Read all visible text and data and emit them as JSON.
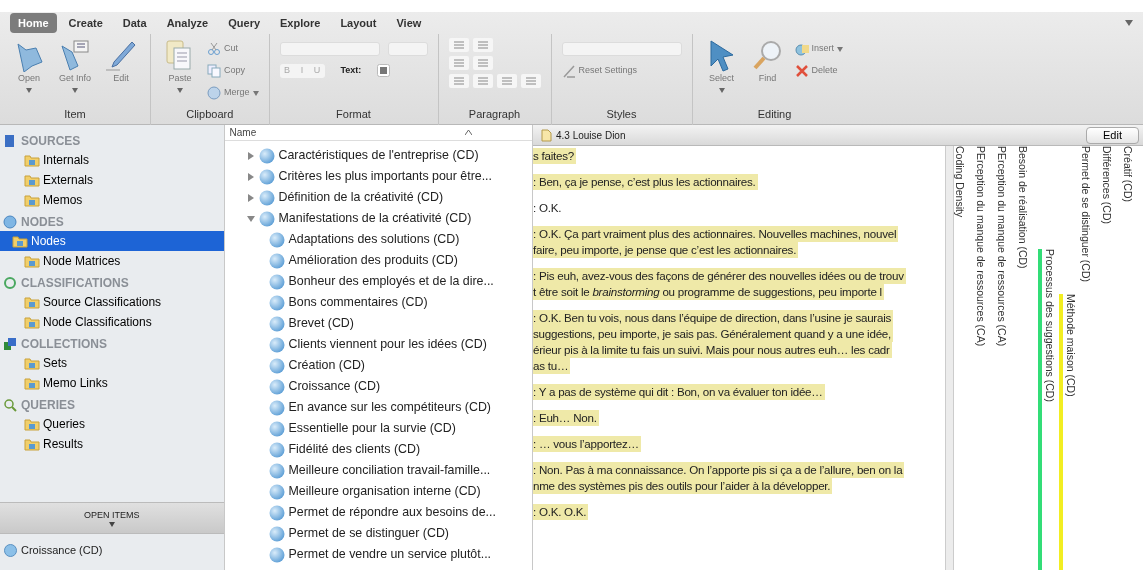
{
  "ribbon": {
    "tabs": [
      {
        "label": "Home",
        "selected": true
      },
      {
        "label": "Create",
        "selected": false
      },
      {
        "label": "Data",
        "selected": false
      },
      {
        "label": "Analyze",
        "selected": false
      },
      {
        "label": "Query",
        "selected": false
      },
      {
        "label": "Explore",
        "selected": false
      },
      {
        "label": "Layout",
        "selected": false
      },
      {
        "label": "View",
        "selected": false
      }
    ],
    "groups": [
      {
        "label": "Item",
        "controls": [
          {
            "kind": "large",
            "label": "Open",
            "disabled": true,
            "menu": true
          },
          {
            "kind": "large",
            "label": "Get Info",
            "disabled": true,
            "menu": true
          },
          {
            "kind": "large",
            "label": "Edit",
            "disabled": true,
            "menu": false
          }
        ]
      },
      {
        "label": "Clipboard",
        "controls": [
          {
            "kind": "large",
            "label": "Paste",
            "disabled": true,
            "menu": true
          },
          {
            "kind": "small",
            "label": "Cut",
            "disabled": true,
            "menu": false
          },
          {
            "kind": "small",
            "label": "Copy",
            "disabled": true,
            "menu": false
          },
          {
            "kind": "small",
            "label": "Merge",
            "disabled": true,
            "menu": true
          }
        ]
      },
      {
        "label": "Format",
        "controls": [
          {
            "kind": "selects"
          },
          {
            "kind": "style-buttons",
            "labels": [
              "B",
              "I",
              "U"
            ],
            "disabled": true
          },
          {
            "kind": "color",
            "label": "Text:"
          }
        ]
      },
      {
        "label": "Paragraph",
        "controls": [
          {
            "kind": "paragraph"
          }
        ]
      },
      {
        "label": "Styles",
        "controls": [
          {
            "kind": "style-select"
          },
          {
            "kind": "small",
            "label": "Reset Settings",
            "disabled": true,
            "menu": false
          }
        ]
      },
      {
        "label": "Editing",
        "controls": [
          {
            "kind": "large",
            "label": "Select",
            "disabled": true,
            "menu": true
          },
          {
            "kind": "large",
            "label": "Find",
            "disabled": true,
            "menu": false
          },
          {
            "kind": "small",
            "label": "Insert",
            "disabled": true,
            "menu": true
          },
          {
            "kind": "small",
            "label": "Delete",
            "disabled": true,
            "menu": false
          }
        ]
      }
    ]
  },
  "sidebar": {
    "sections": [
      {
        "title": "SOURCES",
        "items": [
          {
            "label": "Internals",
            "selected": false
          },
          {
            "label": "Externals",
            "selected": false
          },
          {
            "label": "Memos",
            "selected": false
          }
        ]
      },
      {
        "title": "NODES",
        "items": [
          {
            "label": "Nodes",
            "selected": true
          },
          {
            "label": "Node Matrices",
            "selected": false
          }
        ]
      },
      {
        "title": "CLASSIFICATIONS",
        "items": [
          {
            "label": "Source Classifications",
            "selected": false
          },
          {
            "label": "Node Classifications",
            "selected": false
          }
        ]
      },
      {
        "title": "COLLECTIONS",
        "items": [
          {
            "label": "Sets",
            "selected": false
          },
          {
            "label": "Memo Links",
            "selected": false
          }
        ]
      },
      {
        "title": "QUERIES",
        "items": [
          {
            "label": "Queries",
            "selected": false
          },
          {
            "label": "Results",
            "selected": false
          }
        ]
      }
    ],
    "open_items_label": "OPEN ITEMS",
    "open_items": [
      "Croissance (CD)"
    ]
  },
  "node_list": {
    "column": "Name",
    "nodes": [
      {
        "label": "Caractéristiques de l'entreprise (CD)",
        "expanded": false
      },
      {
        "label": "Critères les plus importants pour être...",
        "expanded": false
      },
      {
        "label": "Définition de la créativité (CD)",
        "expanded": false
      },
      {
        "label": "Manifestations de la créativité (CD)",
        "expanded": true,
        "children": [
          {
            "label": "Adaptations des solutions (CD)"
          },
          {
            "label": "Amélioration des produits (CD)"
          },
          {
            "label": "Bonheur des employés et de la dire..."
          },
          {
            "label": "Bons commentaires (CD)"
          },
          {
            "label": "Brevet (CD)"
          },
          {
            "label": "Clients viennent pour les idées (CD)"
          },
          {
            "label": "Création (CD)"
          },
          {
            "label": "Croissance (CD)"
          },
          {
            "label": "En avance sur les compétiteurs (CD)"
          },
          {
            "label": "Essentielle pour la survie (CD)"
          },
          {
            "label": "Fidélité des clients (CD)"
          },
          {
            "label": "Meilleure conciliation travail-famille..."
          },
          {
            "label": "Meilleure organisation interne (CD)"
          },
          {
            "label": "Permet de répondre aux besoins de..."
          },
          {
            "label": "Permet de se distinguer (CD)"
          },
          {
            "label": "Permet de vendre un service plutôt..."
          }
        ]
      }
    ]
  },
  "document": {
    "title": "4.3 Louise Dion",
    "edit_button": "Edit",
    "paragraphs": [
      {
        "highlighted": true,
        "lines": [
          "s faites?"
        ]
      },
      {
        "highlighted": true,
        "lines": [
          ": Ben, ça je pense, c’est plus les actionnaires."
        ]
      },
      {
        "highlighted": false,
        "lines": [
          ": O.K."
        ]
      },
      {
        "highlighted": true,
        "lines": [
          ": O.K. Ça part vraiment plus des actionnaires. Nouvelles machines, nouvel",
          "faire, peu importe, je pense que c’est les actionnaires."
        ]
      },
      {
        "highlighted": true,
        "lines": [
          ": Pis euh, avez-vous des façons de générer des nouvelles idées ou de trouv",
          "t être soit le *brainstorming* ou programme de suggestions, peu importe l"
        ]
      },
      {
        "highlighted": true,
        "lines": [
          ": O.K. Ben tu vois, nous dans l’équipe de direction, dans l’usine je saurais",
          "suggestions, peu importe, je sais pas. Généralement quand y a une idée,",
          "érieur pis à la limite tu fais un suivi. Mais pour nous autres euh… les cadr",
          "as tu…"
        ]
      },
      {
        "highlighted": true,
        "lines": [
          ": Y a pas de système qui dit : Bon, on va évaluer ton idée…"
        ]
      },
      {
        "highlighted": true,
        "lines": [
          ": Euh… Non."
        ]
      },
      {
        "highlighted": true,
        "lines": [
          ": … vous l’apportez…"
        ]
      },
      {
        "highlighted": true,
        "lines": [
          ": Non. Pas à ma connaissance. On l’apporte pis si ça a de l’allure, ben on la",
          "nme des systèmes pis des outils pour l’aider à la développer."
        ]
      },
      {
        "highlighted": true,
        "lines": [
          ": O.K. O.K."
        ]
      }
    ]
  },
  "coding_stripes": [
    {
      "label": "Coding Density"
    },
    {
      "label": "PErception du manque de ressources (CA)"
    },
    {
      "label": "PErception du manque de ressources (CA)"
    },
    {
      "label": "Besoin de réalisation (CD)"
    },
    {
      "label": "Processus des suggestions (CD)",
      "color": "#33dd77"
    },
    {
      "label": "Méthode maison (CD)",
      "color": "#f2ee22"
    },
    {
      "label": "Permet de se distinguer (CD)"
    },
    {
      "label": "Différences (CD)"
    },
    {
      "label": "Créatif (CD)"
    }
  ]
}
